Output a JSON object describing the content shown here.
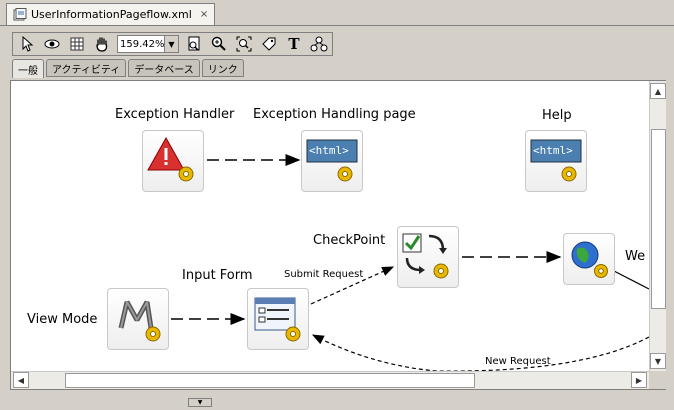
{
  "file_tab": {
    "title": "UserInformationPageflow.xml",
    "close": "×"
  },
  "toolbar": {
    "buttons": [
      "select-icon",
      "eye-icon",
      "grid-icon",
      "hand-icon"
    ],
    "zoom_value": "159.42%",
    "zoom_drop": "▼",
    "buttons_right": [
      "page-icon",
      "zoom-in-icon",
      "zoom-fit-icon",
      "tag-icon",
      "text-icon",
      "node-icon"
    ],
    "text_tool": "T"
  },
  "palette_tabs": [
    "一般",
    "アクティビティ",
    "データベース",
    "リンク"
  ],
  "nodes": {
    "exception_handler": "Exception Handler",
    "exception_page": "Exception Handling page",
    "help": "Help",
    "checkpoint": "CheckPoint",
    "input_form": "Input Form",
    "view_mode": "View Mode",
    "web": "We"
  },
  "edges": {
    "submit_request": "Submit Request",
    "new_request": "New Request"
  },
  "html_badge": "<html>",
  "scroll": {
    "up": "▲",
    "down": "▼",
    "left": "◀",
    "right": "▶"
  },
  "bottom_grip": "▼"
}
